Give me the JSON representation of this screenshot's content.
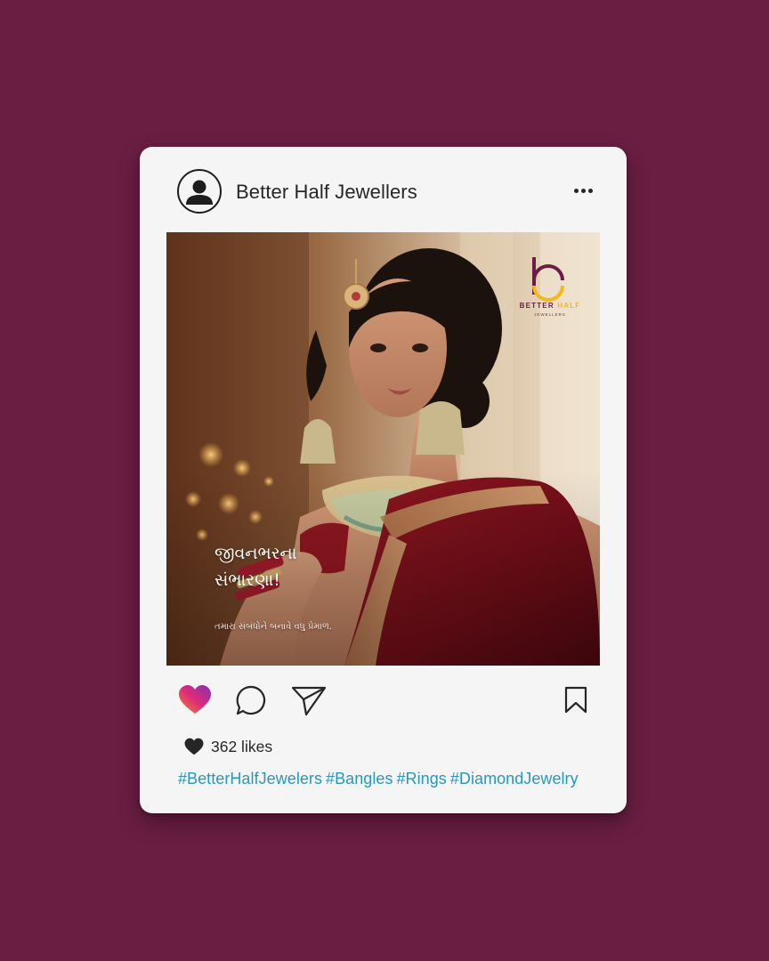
{
  "post": {
    "account_name": "Better Half Jewellers",
    "image": {
      "brand_line1_a": "BETTER",
      "brand_line1_b": "HALF",
      "brand_line2": "JEWELLERS",
      "headline_line1": "જીવનભરના",
      "headline_line2": "સંભારણા!",
      "subline": "તમારા સંબંધોને બનાવે વધુ પ્રેમાળ."
    },
    "likes": "362 likes",
    "hashtags": [
      "#BetterHalfJewelers",
      "#Bangles",
      "#Rings",
      "#DiamondJewelry"
    ]
  },
  "icons": {
    "avatar": "user-avatar-icon",
    "more": "more-dots-icon",
    "like": "heart-icon",
    "comment": "comment-bubble-icon",
    "share": "paper-plane-icon",
    "save": "bookmark-icon"
  },
  "colors": {
    "background": "#6a1e42",
    "card": "#f5f5f5",
    "hashtag": "#2a97b8",
    "brand_plum": "#6b1e45",
    "brand_gold": "#f3b91b",
    "like_gradient_start": "#f58529",
    "like_gradient_end": "#8134af"
  }
}
